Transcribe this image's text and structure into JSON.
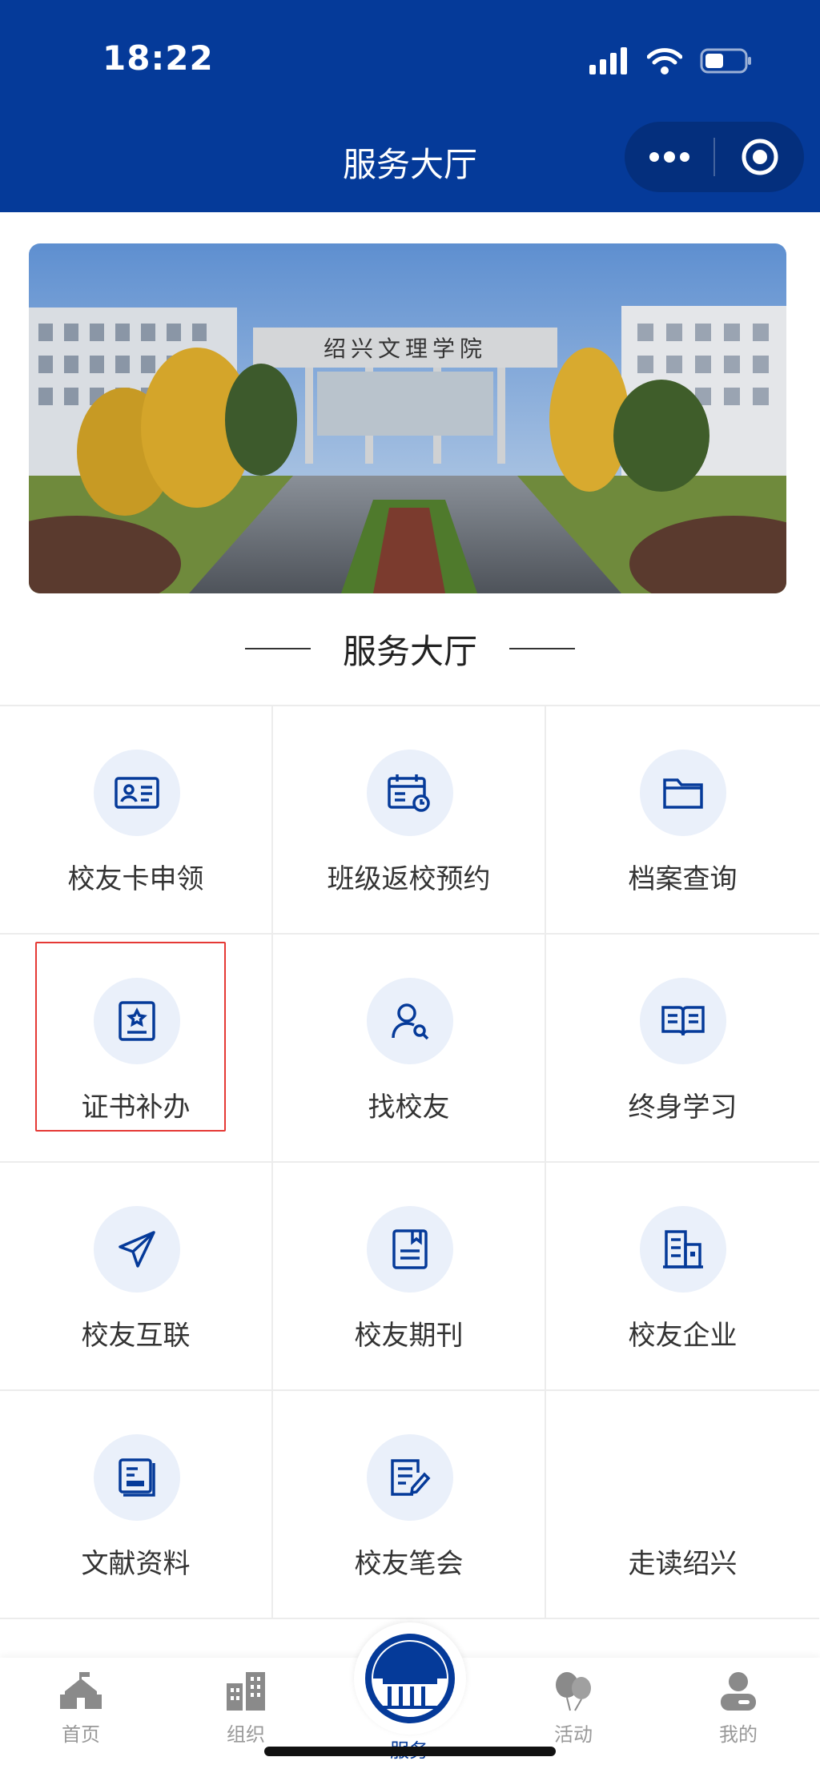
{
  "status_bar": {
    "time": "18:22"
  },
  "nav": {
    "title": "服务大厅"
  },
  "banner": {
    "gate_text": "绍兴文理学院"
  },
  "section": {
    "title": "服务大厅"
  },
  "grid": {
    "items": [
      {
        "label": "校友卡申领",
        "icon": "id-card-icon"
      },
      {
        "label": "班级返校预约",
        "icon": "calendar-icon"
      },
      {
        "label": "档案查询",
        "icon": "folder-icon"
      },
      {
        "label": "证书补办",
        "icon": "certificate-icon"
      },
      {
        "label": "找校友",
        "icon": "find-person-icon"
      },
      {
        "label": "终身学习",
        "icon": "open-book-icon"
      },
      {
        "label": "校友互联",
        "icon": "paper-plane-icon"
      },
      {
        "label": "校友期刊",
        "icon": "journal-icon"
      },
      {
        "label": "校友企业",
        "icon": "building-icon"
      },
      {
        "label": "文献资料",
        "icon": "document-icon"
      },
      {
        "label": "校友笔会",
        "icon": "pen-notes-icon"
      },
      {
        "label": "走读绍兴",
        "icon": ""
      }
    ]
  },
  "tabbar": {
    "tabs": [
      {
        "label": "首页",
        "icon": "home-school-icon"
      },
      {
        "label": "组织",
        "icon": "buildings-icon"
      },
      {
        "label": "服务",
        "icon": "school-logo-icon",
        "active": true
      },
      {
        "label": "活动",
        "icon": "balloons-icon"
      },
      {
        "label": "我的",
        "icon": "user-icon"
      }
    ]
  },
  "colors": {
    "primary": "#053a99",
    "icon_bg": "#eaf0fa",
    "highlight": "#e53935"
  }
}
